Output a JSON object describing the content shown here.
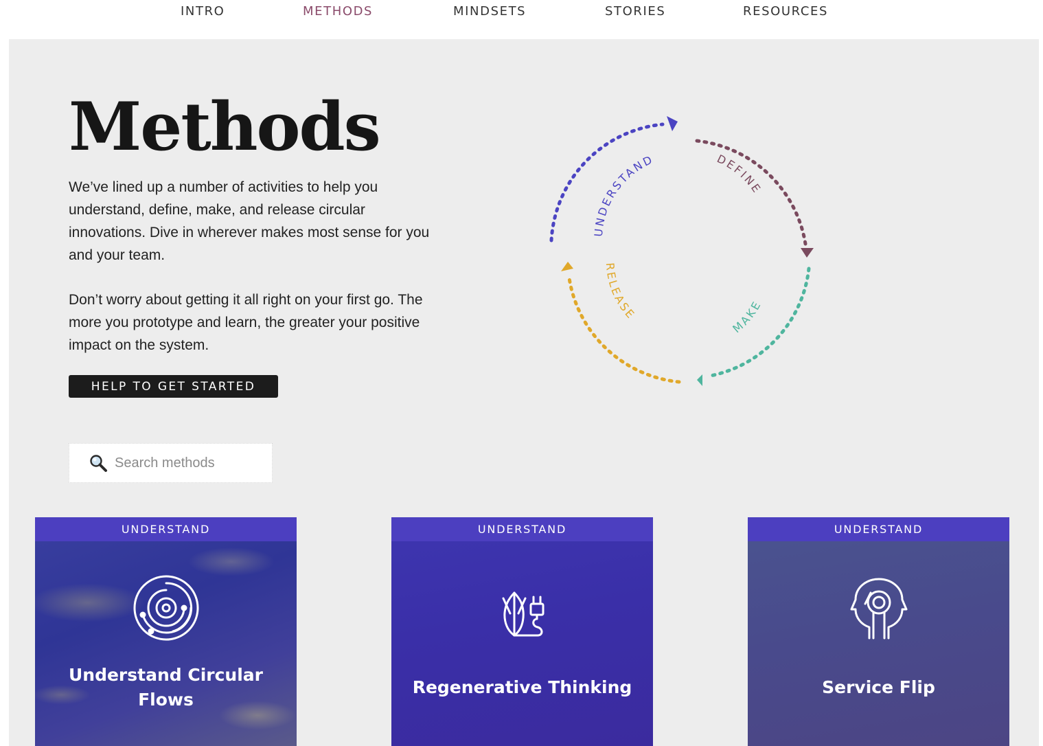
{
  "nav": {
    "items": [
      {
        "label": "INTRO",
        "active": false
      },
      {
        "label": "METHODS",
        "active": true
      },
      {
        "label": "MINDSETS",
        "active": false
      },
      {
        "label": "STORIES",
        "active": false
      },
      {
        "label": "RESOURCES",
        "active": false
      }
    ]
  },
  "hero": {
    "title": "Methods",
    "paragraph_1": "We’ve lined up a number of activities to help you understand, define, make, and release circular innovations. Dive in wherever makes most sense for you and your team.",
    "paragraph_2": "Don’t worry about getting it all right on your first go. The more you prototype and learn, the greater your positive impact on the system.",
    "help_button_label": "HELP TO GET STARTED"
  },
  "search": {
    "placeholder": "Search methods",
    "value": "",
    "icon": "magnifier-icon"
  },
  "cycle": {
    "stages": [
      {
        "label": "UNDERSTAND",
        "color": "#4b44c2"
      },
      {
        "label": "DEFINE",
        "color": "#7a4a5e"
      },
      {
        "label": "MAKE",
        "color": "#4fb59e"
      },
      {
        "label": "RELEASE",
        "color": "#e0a82a"
      }
    ]
  },
  "cards": [
    {
      "category": "UNDERSTAND",
      "title": "Understand Circular Flows",
      "icon": "circular-orbit-icon"
    },
    {
      "category": "UNDERSTAND",
      "title": "Regenerative Thinking",
      "icon": "plant-plug-icon"
    },
    {
      "category": "UNDERSTAND",
      "title": "Service Flip",
      "icon": "head-profile-icon"
    }
  ],
  "colors": {
    "active_nav": "#8a4a6a",
    "panel_bg": "#ededed",
    "card_band": "#4c3fc0",
    "button_bg": "#1c1c1c"
  }
}
